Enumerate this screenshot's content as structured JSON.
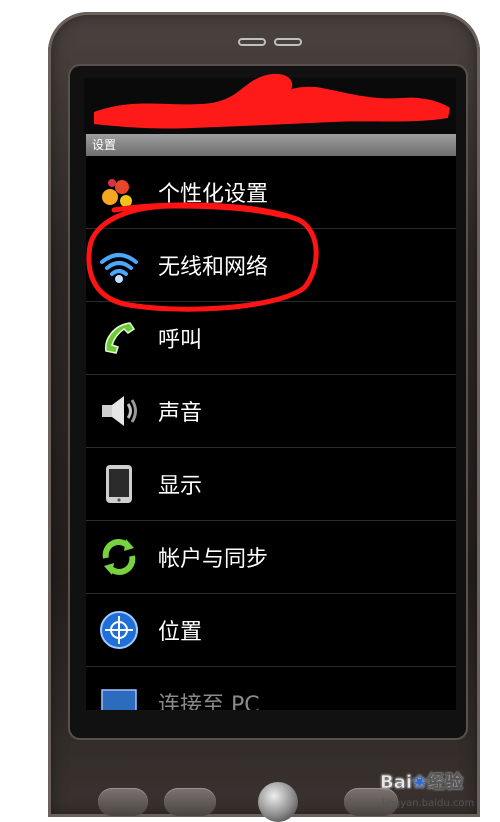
{
  "window": {
    "title": "设置"
  },
  "settings": {
    "items": [
      {
        "label": "个性化设置",
        "icon": "personalize-icon"
      },
      {
        "label": "无线和网络",
        "icon": "wifi-icon"
      },
      {
        "label": "呼叫",
        "icon": "phone-call-icon"
      },
      {
        "label": "声音",
        "icon": "speaker-icon"
      },
      {
        "label": "显示",
        "icon": "display-icon"
      },
      {
        "label": "帐户与同步",
        "icon": "sync-icon"
      },
      {
        "label": "位置",
        "icon": "location-icon"
      },
      {
        "label": "连接至 PC",
        "icon": "pc-connect-icon"
      }
    ]
  },
  "annotation": {
    "highlight_color": "#ff0000",
    "highlighted_item": "无线和网络"
  },
  "watermark": {
    "brand": "Bai",
    "brand_tail": "经验",
    "site": "jingyan.baidu.com"
  }
}
